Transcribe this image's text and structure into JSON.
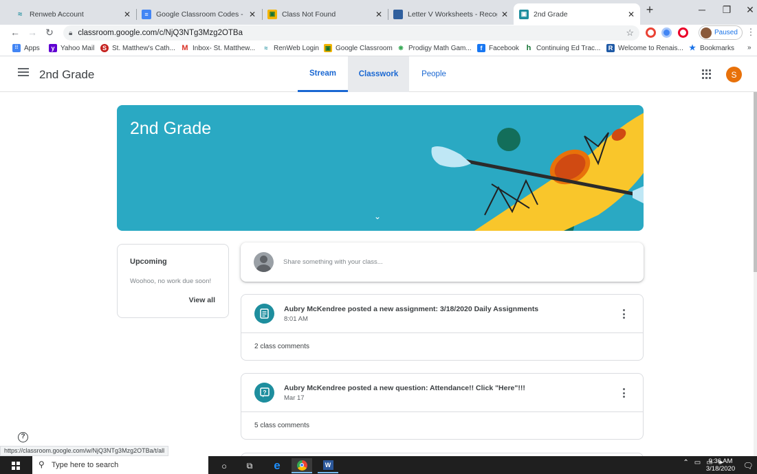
{
  "browser": {
    "tabs": [
      {
        "title": "Renweb Account"
      },
      {
        "title": "Google Classroom Codes - Goog"
      },
      {
        "title": "Class Not Found"
      },
      {
        "title": "Letter V Worksheets - Recognize"
      },
      {
        "title": "2nd Grade"
      }
    ],
    "new_tab": "+",
    "url": "classroom.google.com/c/NjQ3NTg3Mzg2OTBa",
    "profile_status": "Paused",
    "bookmarks": [
      {
        "label": "Apps"
      },
      {
        "label": "Yahoo Mail"
      },
      {
        "label": "St. Matthew's Cath..."
      },
      {
        "label": "Inbox- St. Matthew..."
      },
      {
        "label": "RenWeb Login"
      },
      {
        "label": "Google Classroom"
      },
      {
        "label": "Prodigy Math Gam..."
      },
      {
        "label": "Facebook"
      },
      {
        "label": "Continuing Ed Trac..."
      },
      {
        "label": "Welcome to Renais..."
      },
      {
        "label": "Bookmarks"
      }
    ],
    "bookmarks_more": "»",
    "status_url": "https://classroom.google.com/w/NjQ3NTg3Mzg2OTBa/t/all"
  },
  "classroom": {
    "class_name": "2nd Grade",
    "tabs": [
      {
        "label": "Stream"
      },
      {
        "label": "Classwork"
      },
      {
        "label": "People"
      }
    ],
    "user_initial": "S",
    "banner_title": "2nd Grade",
    "upcoming": {
      "title": "Upcoming",
      "empty_text": "Woohoo, no work due soon!",
      "view_all": "View all"
    },
    "share_placeholder": "Share something with your class...",
    "posts": [
      {
        "title": "Aubry McKendree posted a new assignment: 3/18/2020 Daily Assignments",
        "time": "8:01 AM",
        "comments": "2 class comments",
        "icon": "assignment-icon"
      },
      {
        "title": "Aubry McKendree posted a new question: Attendance!! Click \"Here\"!!!",
        "time": "Mar 17",
        "comments": "5 class comments",
        "icon": "question-icon"
      }
    ]
  },
  "taskbar": {
    "search_placeholder": "Type here to search",
    "time": "9:36 AM",
    "date": "3/18/2020"
  },
  "colors": {
    "banner": "#2aa9c3",
    "accent": "#1967d2",
    "avatar": "#e8710a",
    "post_icon": "#1e8e9e"
  }
}
